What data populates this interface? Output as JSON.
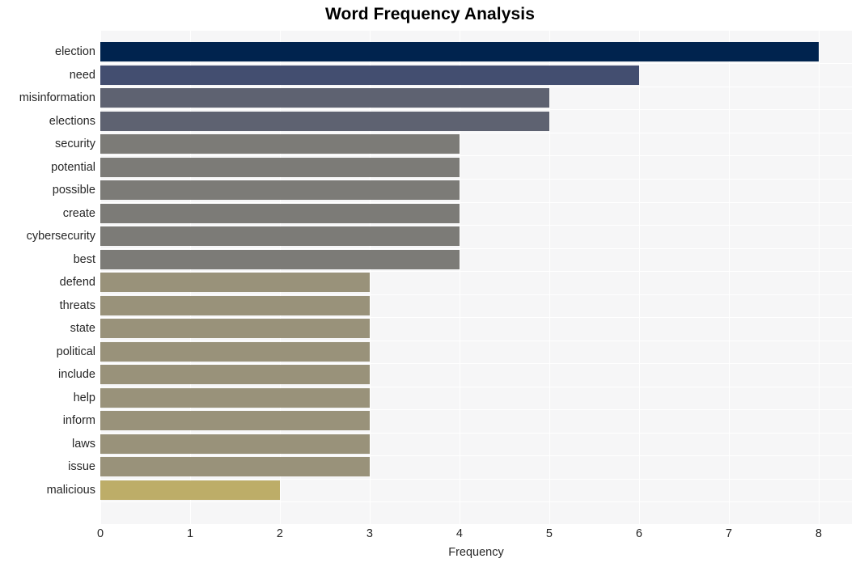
{
  "chart_data": {
    "type": "bar",
    "orientation": "horizontal",
    "title": "Word Frequency Analysis",
    "xlabel": "Frequency",
    "ylabel": "",
    "xlim": [
      0,
      8.37
    ],
    "xticks": [
      0,
      1,
      2,
      3,
      4,
      5,
      6,
      7,
      8
    ],
    "xtick_labels": [
      "0",
      "1",
      "2",
      "3",
      "4",
      "5",
      "6",
      "7",
      "8"
    ],
    "grid": true,
    "grid_color": "#ffffff",
    "legend": "none",
    "plot_background": "#f6f6f7",
    "figure_background": "#ffffff",
    "categories": [
      "election",
      "need",
      "misinformation",
      "elections",
      "security",
      "potential",
      "possible",
      "create",
      "cybersecurity",
      "best",
      "defend",
      "threats",
      "state",
      "political",
      "include",
      "help",
      "inform",
      "laws",
      "issue",
      "malicious"
    ],
    "values": [
      8,
      6,
      5,
      5,
      4,
      4,
      4,
      4,
      4,
      4,
      3,
      3,
      3,
      3,
      3,
      3,
      3,
      3,
      3,
      2
    ],
    "bar_colors": [
      "#00234e",
      "#434e70",
      "#5e6271",
      "#5e6271",
      "#7c7b77",
      "#7c7b77",
      "#7c7b77",
      "#7c7b77",
      "#7c7b77",
      "#7c7b77",
      "#99927a",
      "#99927a",
      "#99927a",
      "#99927a",
      "#99927a",
      "#99927a",
      "#99927a",
      "#99927a",
      "#99927a",
      "#bdad68"
    ]
  }
}
